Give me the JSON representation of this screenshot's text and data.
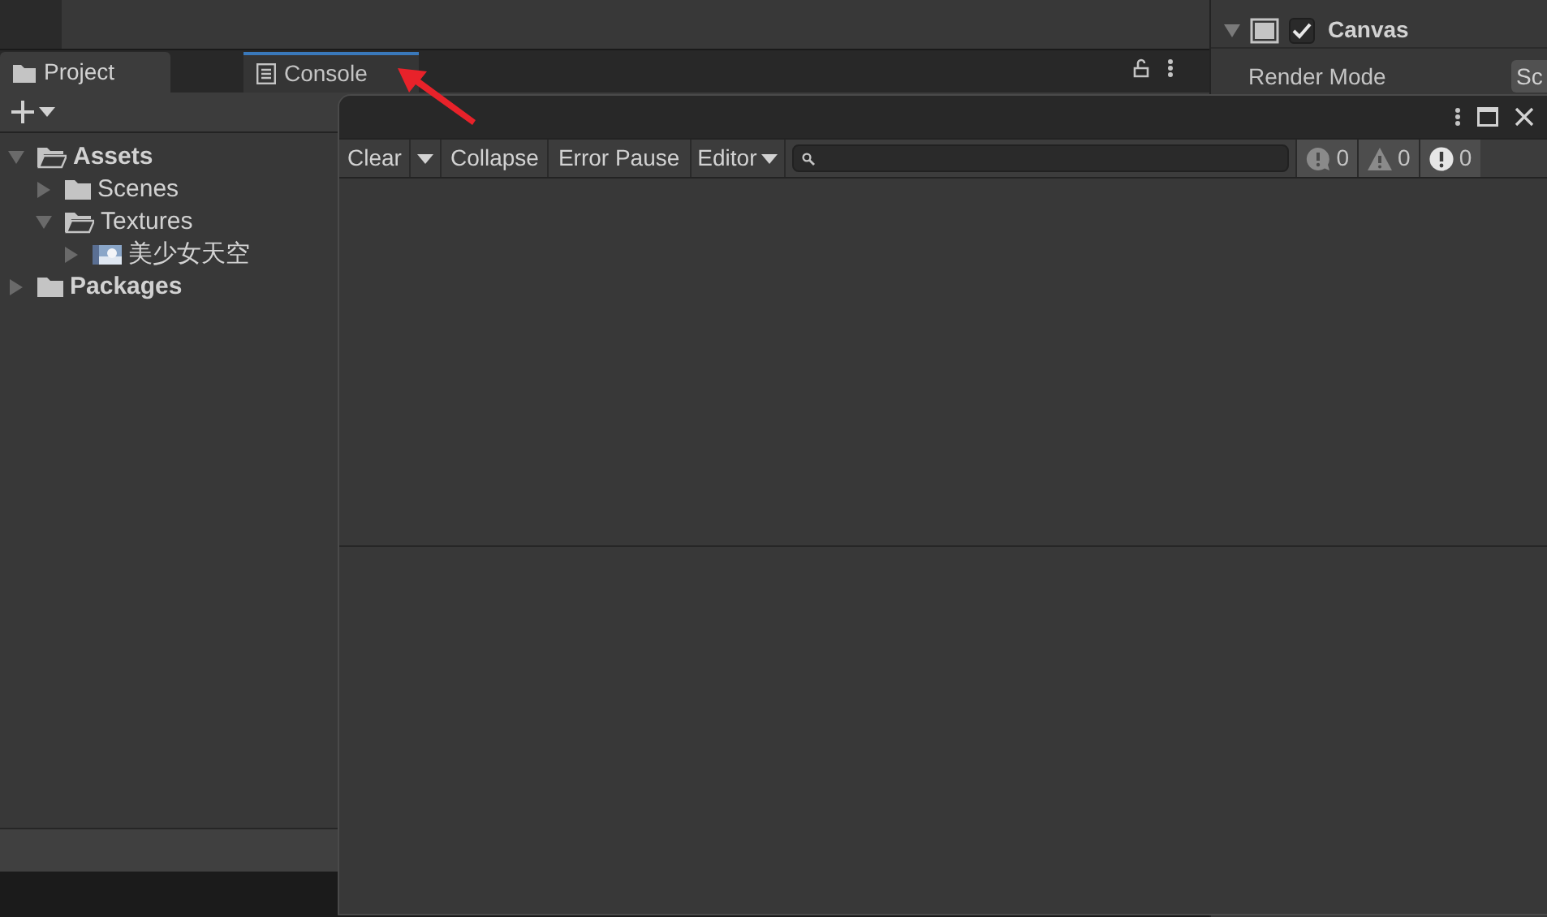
{
  "dock": {
    "tabs": [
      {
        "label": "Project",
        "kind": "folder",
        "selected": true
      },
      {
        "label": "Console",
        "kind": "console",
        "selected": false
      }
    ]
  },
  "project": {
    "tree": [
      {
        "label": "Assets",
        "bold": true,
        "expanded": true,
        "children": [
          {
            "label": "Scenes",
            "bold": false,
            "expanded": false,
            "kind": "folder"
          },
          {
            "label": "Textures",
            "bold": false,
            "expanded": true,
            "kind": "folder",
            "children": [
              {
                "label": "美少女天空",
                "bold": false,
                "expanded": false,
                "kind": "picture"
              }
            ]
          }
        ],
        "kind": "folder"
      },
      {
        "label": "Packages",
        "bold": true,
        "expanded": false,
        "kind": "folder"
      }
    ]
  },
  "inspector": {
    "component": {
      "title": "Canvas",
      "expanded": true,
      "enabled": true
    },
    "render_mode": {
      "label": "Render Mode",
      "value": "Sc"
    }
  },
  "console": {
    "toolbar": {
      "clear": "Clear",
      "collapse": "Collapse",
      "error_pause": "Error Pause",
      "editor": "Editor"
    },
    "counters": [
      {
        "kind": "info",
        "count": "0"
      },
      {
        "kind": "warning",
        "count": "0"
      },
      {
        "kind": "error",
        "count": "0"
      }
    ]
  }
}
